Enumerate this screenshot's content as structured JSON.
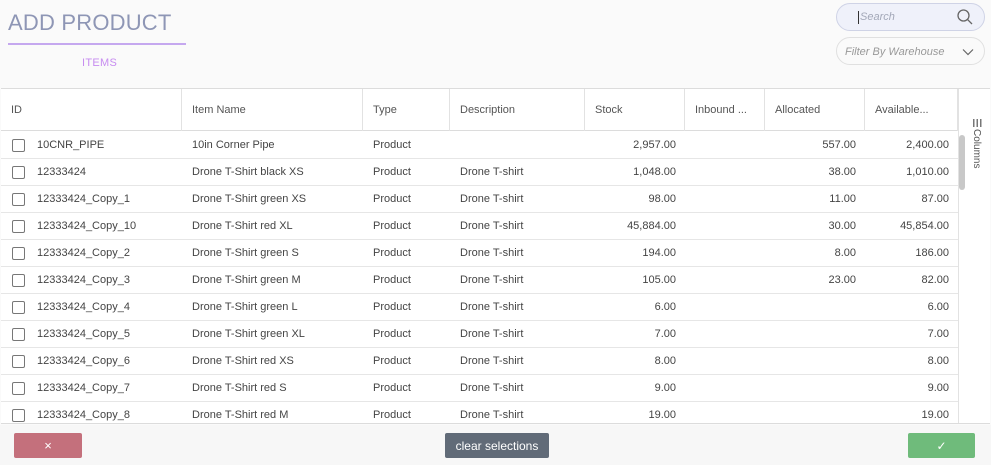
{
  "header": {
    "title": "ADD PRODUCT",
    "tab_label": "ITEMS"
  },
  "search": {
    "placeholder": "Search"
  },
  "filter": {
    "label": "Filter By Warehouse"
  },
  "grid": {
    "columns": [
      "ID",
      "Item Name",
      "Type",
      "Description",
      "Stock",
      "Inbound ...",
      "Allocated",
      "Available..."
    ],
    "side_label": "Columns",
    "rows": [
      {
        "id": "10CNR_PIPE",
        "name": "10in Corner Pipe",
        "type": "Product",
        "description": "",
        "stock": "2,957.00",
        "inbound": "",
        "allocated": "557.00",
        "available": "2,400.00"
      },
      {
        "id": "12333424",
        "name": "Drone T-Shirt black XS",
        "type": "Product",
        "description": "Drone T-shirt",
        "stock": "1,048.00",
        "inbound": "",
        "allocated": "38.00",
        "available": "1,010.00"
      },
      {
        "id": "12333424_Copy_1",
        "name": "Drone T-Shirt green XS",
        "type": "Product",
        "description": "Drone T-shirt",
        "stock": "98.00",
        "inbound": "",
        "allocated": "11.00",
        "available": "87.00"
      },
      {
        "id": "12333424_Copy_10",
        "name": "Drone T-Shirt red XL",
        "type": "Product",
        "description": "Drone T-shirt",
        "stock": "45,884.00",
        "inbound": "",
        "allocated": "30.00",
        "available": "45,854.00"
      },
      {
        "id": "12333424_Copy_2",
        "name": "Drone T-Shirt green S",
        "type": "Product",
        "description": "Drone T-shirt",
        "stock": "194.00",
        "inbound": "",
        "allocated": "8.00",
        "available": "186.00"
      },
      {
        "id": "12333424_Copy_3",
        "name": "Drone T-Shirt green M",
        "type": "Product",
        "description": "Drone T-shirt",
        "stock": "105.00",
        "inbound": "",
        "allocated": "23.00",
        "available": "82.00"
      },
      {
        "id": "12333424_Copy_4",
        "name": "Drone T-Shirt green L",
        "type": "Product",
        "description": "Drone T-shirt",
        "stock": "6.00",
        "inbound": "",
        "allocated": "",
        "available": "6.00"
      },
      {
        "id": "12333424_Copy_5",
        "name": "Drone T-Shirt green XL",
        "type": "Product",
        "description": "Drone T-shirt",
        "stock": "7.00",
        "inbound": "",
        "allocated": "",
        "available": "7.00"
      },
      {
        "id": "12333424_Copy_6",
        "name": "Drone T-Shirt red XS",
        "type": "Product",
        "description": "Drone T-shirt",
        "stock": "8.00",
        "inbound": "",
        "allocated": "",
        "available": "8.00"
      },
      {
        "id": "12333424_Copy_7",
        "name": "Drone T-Shirt red S",
        "type": "Product",
        "description": "Drone T-shirt",
        "stock": "9.00",
        "inbound": "",
        "allocated": "",
        "available": "9.00"
      },
      {
        "id": "12333424_Copy_8",
        "name": "Drone T-Shirt red M",
        "type": "Product",
        "description": "Drone T-shirt",
        "stock": "19.00",
        "inbound": "",
        "allocated": "",
        "available": "19.00"
      }
    ]
  },
  "footer": {
    "cancel_label": "×",
    "clear_label": "clear selections",
    "confirm_label": "✓"
  },
  "colors": {
    "title": "#8e96b5",
    "tab_accent": "#c78cf0",
    "cancel": "#c4707c",
    "clear": "#616b78",
    "confirm": "#6fbb7b"
  },
  "icons": {
    "search": "search-icon",
    "filter_toggle": "chevron-down-icon",
    "columns": "columns-icon",
    "cancel": "close-icon",
    "confirm": "checkmark-icon"
  }
}
